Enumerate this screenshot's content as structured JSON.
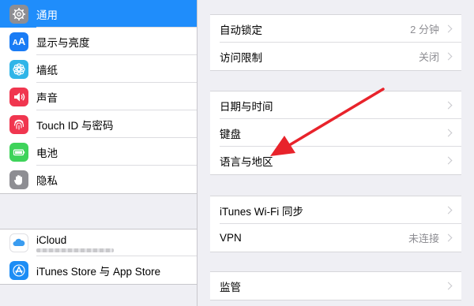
{
  "sidebar": {
    "items": [
      {
        "label": "通用",
        "icon": "gear-icon",
        "color": "#8e8e93",
        "selected": true
      },
      {
        "label": "显示与亮度",
        "icon": "text-size-icon",
        "color": "#1a7cf5"
      },
      {
        "label": "墙纸",
        "icon": "wallpaper-flower-icon",
        "color": "#2fb5e8"
      },
      {
        "label": "声音",
        "icon": "speaker-icon",
        "color": "#f0364f"
      },
      {
        "label": "Touch ID 与密码",
        "icon": "fingerprint-icon",
        "color": "#f0364f"
      },
      {
        "label": "电池",
        "icon": "battery-icon",
        "color": "#3ed35a"
      },
      {
        "label": "隐私",
        "icon": "hand-icon",
        "color": "#8e8e93"
      }
    ],
    "accounts": [
      {
        "label": "iCloud",
        "icon": "icloud-icon",
        "color": "#ffffff"
      },
      {
        "label": "iTunes Store 与 App Store",
        "icon": "app-store-icon",
        "color": "#1d8df5"
      }
    ]
  },
  "panel": {
    "group1": [
      {
        "label": "自动锁定",
        "value": "2 分钟"
      },
      {
        "label": "访问限制",
        "value": "关闭"
      }
    ],
    "group2": [
      {
        "label": "日期与时间"
      },
      {
        "label": "键盘"
      },
      {
        "label": "语言与地区"
      }
    ],
    "group3": [
      {
        "label": "iTunes Wi-Fi 同步"
      },
      {
        "label": "VPN",
        "value": "未连接"
      }
    ],
    "group4": [
      {
        "label": "监管"
      }
    ]
  },
  "annotation": {
    "color": "#e8232b"
  }
}
